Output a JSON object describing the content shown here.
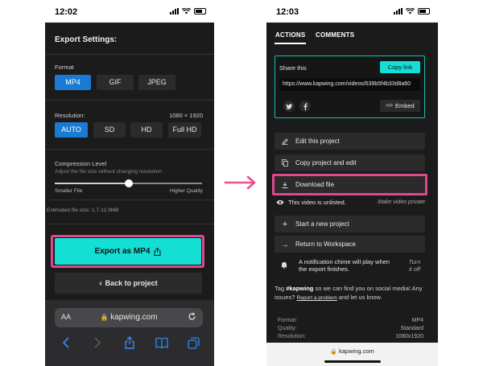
{
  "left_phone": {
    "status_time": "12:02",
    "title": "Export Settings:",
    "format": {
      "label": "Format",
      "options": [
        "MP4",
        "GIF",
        "JPEG"
      ],
      "selected": "MP4"
    },
    "resolution": {
      "label": "Resolution:",
      "value": "1080 × 1920",
      "options": [
        "AUTO",
        "SD",
        "HD",
        "Full HD"
      ],
      "selected": "AUTO"
    },
    "compression": {
      "label": "Compression Level",
      "hint": "Adjust the file size without changing resolution",
      "min_label": "Smaller File",
      "max_label": "Higher Quality",
      "level": 0.5
    },
    "estimated_size": "Estimated file size: 1.7-12.9MB",
    "export_button": "Export as MP4",
    "back_button": "Back to project",
    "browser": {
      "text_size": "AA",
      "url": "kapwing.com"
    }
  },
  "right_phone": {
    "status_time": "12:03",
    "tabs": [
      "ACTIONS",
      "COMMENTS"
    ],
    "share": {
      "title": "Share this",
      "copy_button": "Copy link",
      "url": "https://www.kapwing.com/videos/639b5f4b33d8a60",
      "embed_button": "Embed"
    },
    "actions": {
      "edit": "Edit this project",
      "copy": "Copy project and edit",
      "download": "Download file",
      "new": "Start a new project",
      "workspace": "Return to Workspace"
    },
    "unlisted": {
      "message": "This video is unlisted.",
      "make_private": "Make video private"
    },
    "notification": {
      "text": "A notification chime will play when the export finishes.",
      "toggle": "Turn it off"
    },
    "tag": {
      "prefix": "Tag ",
      "handle": "#kapwing",
      "middle": " so we can find you on social media! Any issues? ",
      "report": "Report a problem",
      "suffix": " and let us know."
    },
    "meta": [
      {
        "label": "Format:",
        "value": "MP4"
      },
      {
        "label": "Quality:",
        "value": "Standard"
      },
      {
        "label": "Resolution:",
        "value": "1080x1920"
      }
    ],
    "browser_url": "kapwing.com"
  },
  "colors": {
    "accent": "#14dfd4",
    "highlight": "#e0488b",
    "selected": "#1a7bd4"
  }
}
